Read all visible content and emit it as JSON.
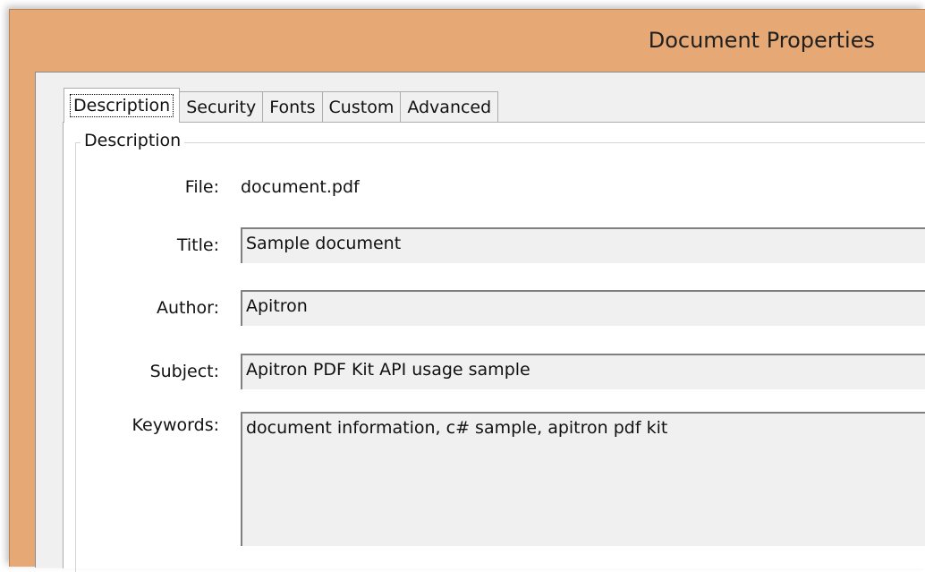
{
  "window": {
    "title": "Document Properties"
  },
  "tabs": [
    {
      "label": "Description",
      "active": true
    },
    {
      "label": "Security",
      "active": false
    },
    {
      "label": "Fonts",
      "active": false
    },
    {
      "label": "Custom",
      "active": false
    },
    {
      "label": "Advanced",
      "active": false
    }
  ],
  "description": {
    "group_label": "Description",
    "file": {
      "label": "File:",
      "value": "document.pdf"
    },
    "title": {
      "label": "Title:",
      "value": "Sample document"
    },
    "author": {
      "label": "Author:",
      "value": "Apitron"
    },
    "subject": {
      "label": "Subject:",
      "value": "Apitron PDF Kit API usage sample"
    },
    "keywords": {
      "label": "Keywords:",
      "value": "document information, c# sample, apitron pdf kit"
    }
  },
  "colors": {
    "titlebar": "#e6a874",
    "client_background": "#f0f0f0",
    "panel_background": "#ffffff",
    "field_background": "#f0f0f0"
  }
}
